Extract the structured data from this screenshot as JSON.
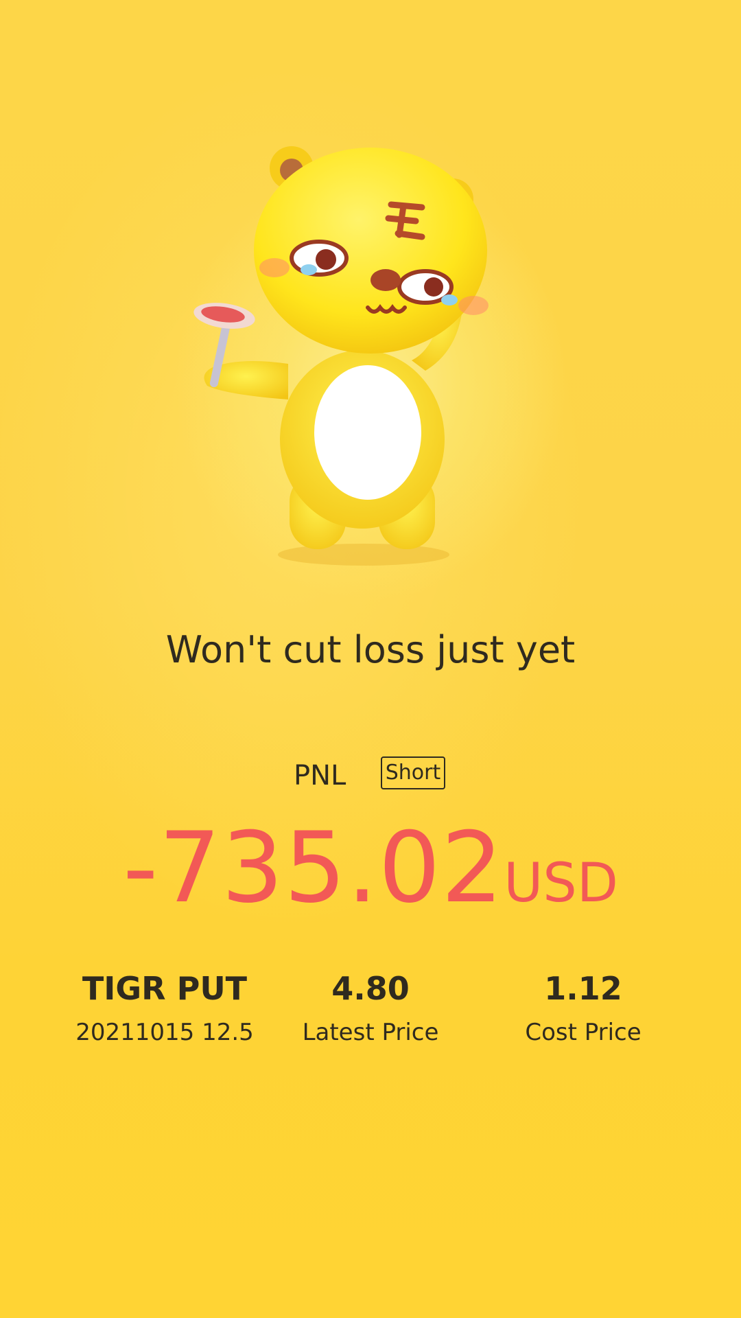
{
  "headline": "Won't cut loss just yet",
  "pnl": {
    "label": "PNL",
    "direction_badge": "Short",
    "value": "-735.02",
    "currency": "USD"
  },
  "position": {
    "symbol": "TIGR PUT",
    "contract": "20211015 12.5",
    "latest_price": "4.80",
    "latest_price_label": "Latest Price",
    "cost_price": "1.12",
    "cost_price_label": "Cost Price"
  },
  "colors": {
    "background": "#fdd33e",
    "loss": "#f25956",
    "text": "#2f2a1f"
  },
  "icons": {
    "mascot": "crying-tiger-mascot-illustration"
  }
}
